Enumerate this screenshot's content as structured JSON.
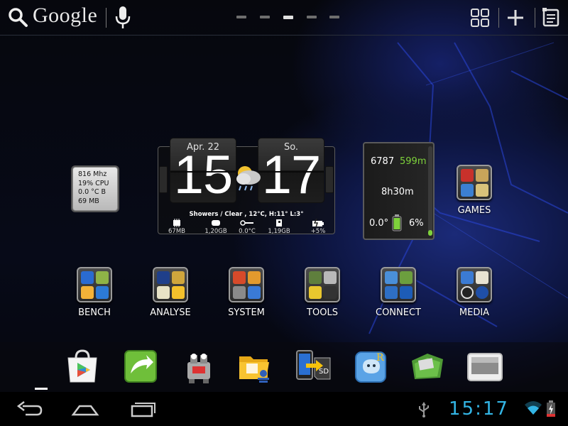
{
  "topbar": {
    "search_label": "Google",
    "page_indicator": {
      "count": 5,
      "active_index": 2
    }
  },
  "cpu_widget": {
    "lines": [
      "816 Mhz",
      "19% CPU",
      "0.0 °C B",
      "69 MB"
    ]
  },
  "clock_widget": {
    "date": "Apr. 22",
    "day": "So.",
    "hour": "15",
    "minute": "17",
    "weather": "Showers / Clear , 12°C, H:11° L:3°",
    "stats": [
      {
        "icon": "ram-chip-icon",
        "value": "67MB"
      },
      {
        "icon": "storage-icon",
        "value": "1,20GB"
      },
      {
        "icon": "thermometer-icon",
        "value": "0.0°C"
      },
      {
        "icon": "sd-card-icon",
        "value": "1,19GB"
      },
      {
        "icon": "battery-charge-icon",
        "value": "+5%"
      }
    ]
  },
  "battery_widget": {
    "steps": "6787",
    "distance": "599m",
    "duration": "8h30m",
    "temperature": "0.0°",
    "battery_percent": "6%",
    "bar_fill_fraction": 0.06
  },
  "folders": {
    "games": "GAMES",
    "bench": "BENCH",
    "analyse": "ANALYSE",
    "system": "SYSTEM",
    "tools": "TOOLS",
    "connect": "CONNECT",
    "media": "MEDIA"
  },
  "dock": {
    "apps": [
      "play-store-icon",
      "dolphin-browser-icon",
      "robot-app-icon",
      "file-manager-icon",
      "sd-transfer-icon",
      "explorer-app-icon",
      "green-folder-app-icon",
      "tablet-app-icon"
    ]
  },
  "statusbar": {
    "time": "15:17"
  },
  "colors": {
    "accent": "#33b5e5",
    "green": "#7ed23b",
    "background": "#05070f"
  }
}
